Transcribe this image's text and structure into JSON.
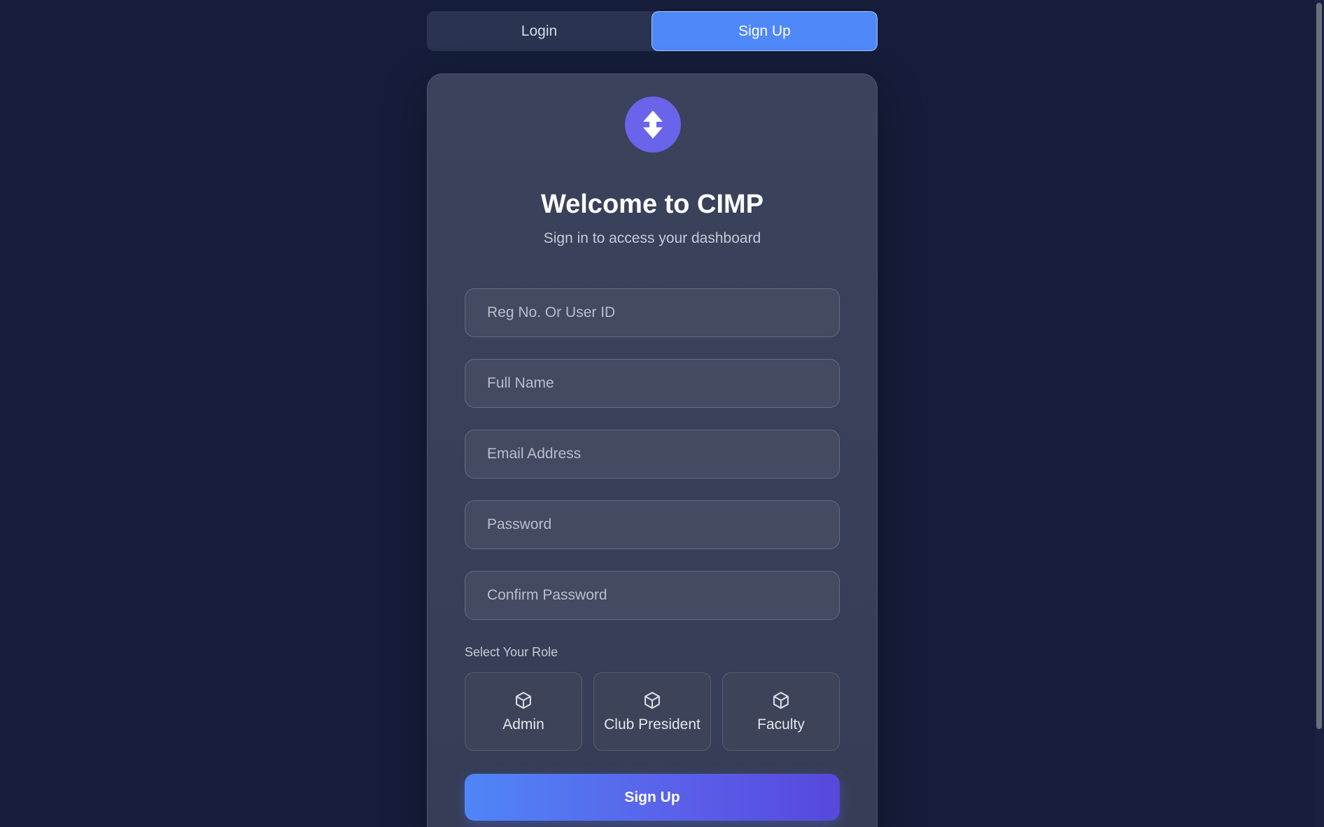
{
  "tabs": [
    {
      "label": "Login",
      "active": false
    },
    {
      "label": "Sign Up",
      "active": true
    }
  ],
  "card": {
    "logo_icon": "up-down-arrow-icon",
    "title": "Welcome to CIMP",
    "subtitle": "Sign in to access your dashboard"
  },
  "form": {
    "reg_placeholder": "Reg No. Or User ID",
    "name_placeholder": "Full Name",
    "email_placeholder": "Email Address",
    "password_placeholder": "Password",
    "confirm_placeholder": "Confirm Password",
    "role_label": "Select Your Role",
    "roles": [
      {
        "label": "Admin",
        "icon": "cube-icon"
      },
      {
        "label": "Club President",
        "icon": "cube-icon"
      },
      {
        "label": "Faculty",
        "icon": "cube-icon"
      }
    ],
    "submit_label": "Sign Up"
  },
  "colors": {
    "background": "#151d3a",
    "accent": "#4f88f8",
    "logo": "#6a64ea",
    "button_gradient_end": "#5648dc"
  }
}
